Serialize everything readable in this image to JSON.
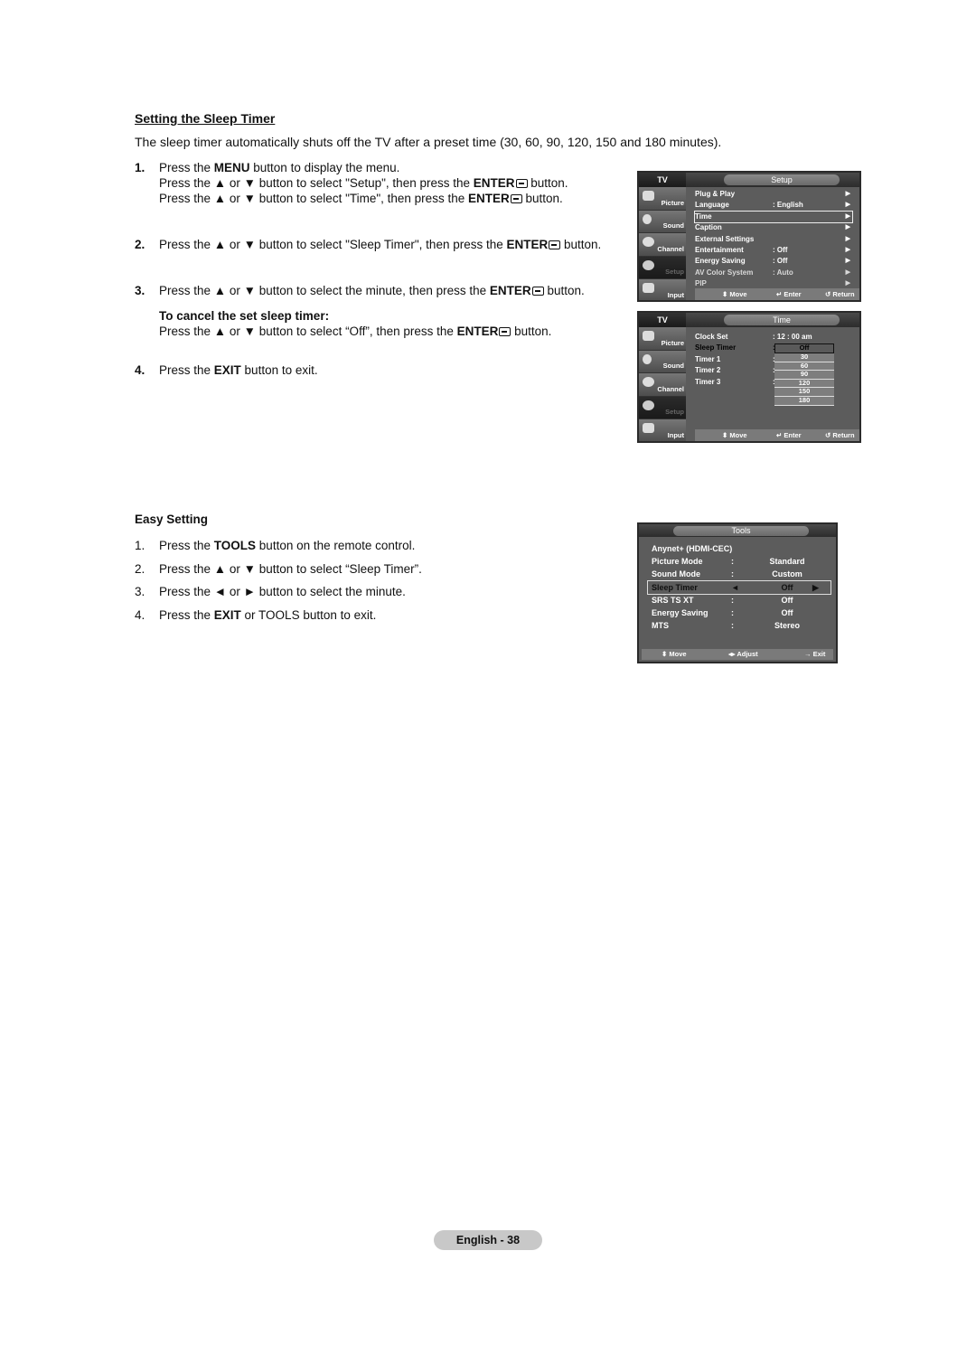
{
  "section_title": "Setting the Sleep Timer",
  "intro": "The sleep timer automatically shuts off the TV after a preset time (30, 60, 90, 120, 150 and 180 minutes).",
  "steps": [
    {
      "num": "1.",
      "lines": [
        [
          "Press the ",
          "MENU",
          " button to display the menu."
        ],
        [
          "Press the ▲ or ▼ button to select \"Setup\", then press the ",
          "ENTER",
          " button."
        ],
        [
          "Press the ▲ or ▼ button to select \"Time\", then press the ",
          "ENTER",
          " button."
        ]
      ]
    },
    {
      "num": "2.",
      "lines": [
        [
          "Press the ▲ or ▼ button to select \"Sleep Timer\", then press the ",
          "ENTER",
          " button."
        ]
      ]
    },
    {
      "num": "3.",
      "lines": [
        [
          "Press the ▲ or ▼ button to select the minute, then press the ",
          "ENTER",
          " button."
        ]
      ]
    },
    {
      "num": "4.",
      "lines": [
        [
          "Press the ",
          "EXIT",
          " button to exit."
        ]
      ]
    }
  ],
  "cancel": {
    "heading": "To cancel the set sleep timer:",
    "text": [
      "Press the ▲ or ▼ button to select “Off”, then press the ",
      "ENTER",
      " button."
    ]
  },
  "easy": {
    "heading": "Easy Setting",
    "steps": [
      {
        "num": "1.",
        "parts": [
          "Press the ",
          "TOOLS",
          " button on the remote control."
        ]
      },
      {
        "num": "2.",
        "parts": [
          "Press the ▲ or ▼ button to select “Sleep Timer”.",
          "",
          ""
        ]
      },
      {
        "num": "3.",
        "parts": [
          "Press the ◄ or ► button to select the minute.",
          "",
          ""
        ]
      },
      {
        "num": "4.",
        "parts": [
          "Press the ",
          "EXIT",
          " or TOOLS button to exit."
        ]
      }
    ]
  },
  "osd_setup": {
    "tv": "TV",
    "title": "Setup",
    "side": [
      "Picture",
      "Sound",
      "Channel",
      "Setup",
      "Input"
    ],
    "rows": [
      {
        "label": "Plug & Play",
        "value": ""
      },
      {
        "label": "Language",
        "value": ": English"
      },
      {
        "label": "Time",
        "value": ""
      },
      {
        "label": "Caption",
        "value": ""
      },
      {
        "label": "External Settings",
        "value": ""
      },
      {
        "label": "Entertainment",
        "value": ": Off"
      },
      {
        "label": "Energy Saving",
        "value": ": Off"
      },
      {
        "label": "AV Color System",
        "value": ": Auto"
      },
      {
        "label": "PIP",
        "value": ""
      }
    ],
    "footer": {
      "move": "⬍ Move",
      "enter": "↵ Enter",
      "return": "↺ Return"
    }
  },
  "osd_time": {
    "tv": "TV",
    "title": "Time",
    "side": [
      "Picture",
      "Sound",
      "Channel",
      "Setup",
      "Input"
    ],
    "rows": [
      {
        "label": "Clock Set",
        "value": ": 12 : 00 am"
      },
      {
        "label": "Sleep Timer",
        "value": ":"
      },
      {
        "label": "Timer 1",
        "value": ":"
      },
      {
        "label": "Timer 2",
        "value": ":"
      },
      {
        "label": "Timer 3",
        "value": ":"
      }
    ],
    "dropdown": [
      "Off",
      "30",
      "60",
      "90",
      "120",
      "150",
      "180"
    ],
    "footer": {
      "move": "⬍ Move",
      "enter": "↵ Enter",
      "return": "↺ Return"
    }
  },
  "osd_tools": {
    "title": "Tools",
    "rows": [
      {
        "label": "Anynet+ (HDMI-CEC)",
        "sep": "",
        "value": ""
      },
      {
        "label": "Picture Mode",
        "sep": ":",
        "value": "Standard"
      },
      {
        "label": "Sound Mode",
        "sep": ":",
        "value": "Custom"
      },
      {
        "label": "Sleep Timer",
        "sep": "◄",
        "value": "Off"
      },
      {
        "label": "SRS TS XT",
        "sep": ":",
        "value": "Off"
      },
      {
        "label": "Energy Saving",
        "sep": ":",
        "value": "Off"
      },
      {
        "label": "MTS",
        "sep": ":",
        "value": "Stereo"
      }
    ],
    "footer": {
      "move": "⬍ Move",
      "adjust": "◂▸ Adjust",
      "exit": "→ Exit"
    }
  },
  "page_label": "English - 38"
}
